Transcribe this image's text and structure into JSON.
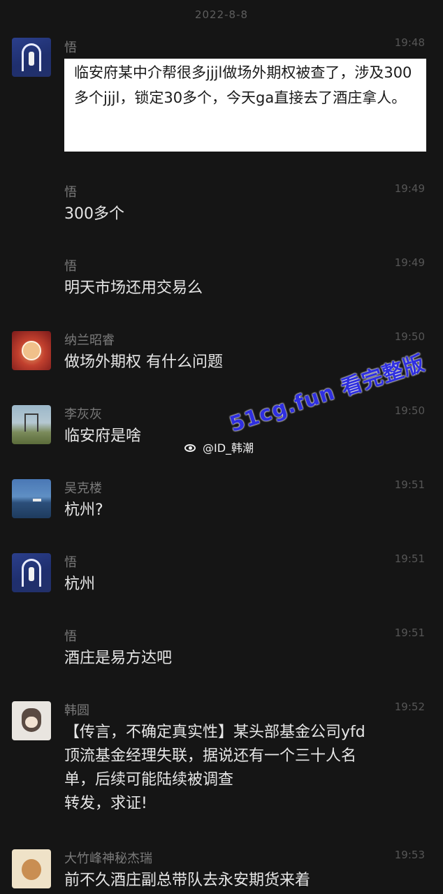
{
  "date_header": "2022-8-8",
  "messages": [
    {
      "sender": "悟",
      "time": "19:48",
      "text": "临安府某中介帮很多jjjl做场外期权被查了，涉及300多个jjjl，锁定30多个，今天ga直接去了酒庄拿人。"
    },
    {
      "sender": "悟",
      "time": "19:49",
      "text": "300多个"
    },
    {
      "sender": "悟",
      "time": "19:49",
      "text": "明天市场还用交易么"
    },
    {
      "sender": "纳兰昭睿",
      "time": "19:50",
      "text": "做场外期权 有什么问题"
    },
    {
      "sender": "李灰灰",
      "time": "19:50",
      "text": "临安府是啥"
    },
    {
      "sender": "吴克楼",
      "time": "19:51",
      "text": "杭州?"
    },
    {
      "sender": "悟",
      "time": "19:51",
      "text": "杭州"
    },
    {
      "sender": "悟",
      "time": "19:51",
      "text": "酒庄是易方达吧"
    },
    {
      "sender": "韩圆",
      "time": "19:52",
      "text": "【传言，不确定真实性】某头部基金公司yfd\n顶流基金经理失联，据说还有一个三十人名\n单，后续可能陆续被调查\n转发，求证!"
    },
    {
      "sender": "大竹峰神秘杰瑞",
      "time": "19:53",
      "text": "前不久酒庄副总带队去永安期货来着"
    }
  ],
  "watermark_text": "51cg.fun 看完整版",
  "weibo_handle": "@ID_韩潮",
  "colors": {
    "background": "#151515",
    "text": "#e6e6e6",
    "meta": "#7a7a7a",
    "watermark": "#2f2fe0"
  }
}
